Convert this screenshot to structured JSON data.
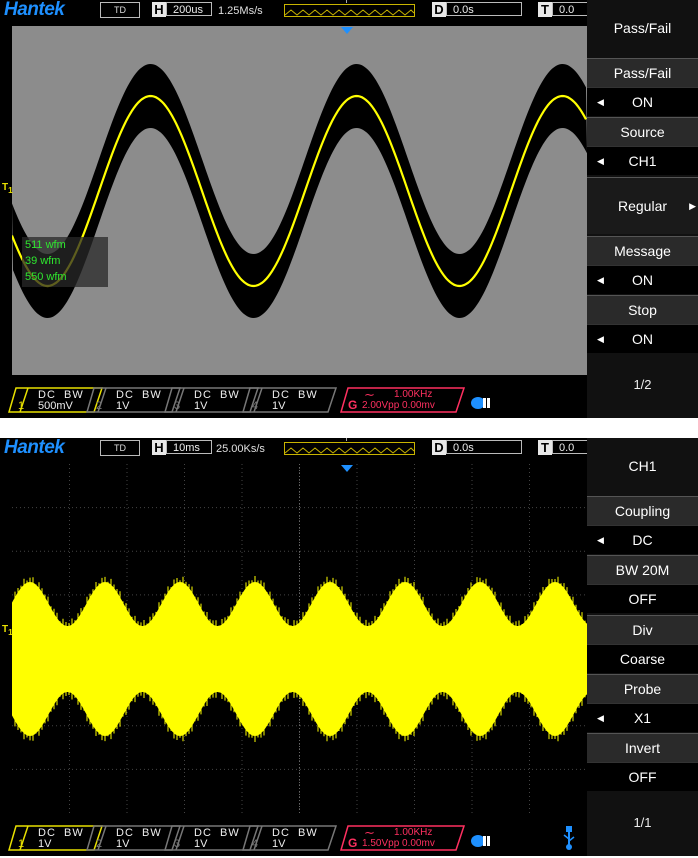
{
  "panels": [
    {
      "brand": "Hantek",
      "mode": "TD",
      "timebase_key": "H",
      "timebase": "200us",
      "sample_rate": "1.25Ms/s",
      "trigger_top_label": "T",
      "delay_key": "D",
      "delay": "0.0s",
      "trigger_key": "T",
      "trigger_value": "0.0",
      "ch_marker": "T",
      "ch_marker_sub": "1",
      "counters": [
        "511 wfm",
        "39 wfm",
        "550 wfm"
      ],
      "menu": {
        "title": "Pass/Fail",
        "items": [
          {
            "label": "Pass/Fail",
            "value": "ON"
          },
          {
            "label": "Source",
            "value": "CH1"
          },
          {
            "single": "Regular"
          },
          {
            "label": "Message",
            "value": "ON"
          },
          {
            "label": "Stop",
            "value": "ON"
          }
        ],
        "page": "1/2"
      },
      "channels": [
        {
          "num": "1",
          "coupling": "DC",
          "bw": "BW",
          "scale": "500mV",
          "color": "#e8e000"
        },
        {
          "num": "2",
          "coupling": "DC",
          "bw": "BW",
          "scale": "1V",
          "color": "#777777"
        },
        {
          "num": "3",
          "coupling": "DC",
          "bw": "BW",
          "scale": "1V",
          "color": "#777777"
        },
        {
          "num": "4",
          "coupling": "DC",
          "bw": "BW",
          "scale": "1V",
          "color": "#777777"
        }
      ],
      "generator": {
        "key": "G",
        "freq": "1.00KHz",
        "amp": "2.00Vpp 0.00mv"
      },
      "colors": {
        "screen_bg": "#8c8c8c",
        "trace": "#ffff00",
        "envelope": "#000000",
        "accent": "#1e90ff"
      }
    },
    {
      "brand": "Hantek",
      "mode": "TD",
      "timebase_key": "H",
      "timebase": "10ms",
      "sample_rate": "25.00Ks/s",
      "trigger_top_label": "T",
      "delay_key": "D",
      "delay": "0.0s",
      "trigger_key": "T",
      "trigger_value": "0.0",
      "ch_marker": "T",
      "ch_marker_sub": "1",
      "menu": {
        "title": "CH1",
        "items": [
          {
            "label": "Coupling",
            "value": "DC"
          },
          {
            "label": "BW 20M",
            "value": "OFF"
          },
          {
            "label": "Div",
            "value": "Coarse"
          },
          {
            "label": "Probe",
            "value": "X1"
          },
          {
            "label": "Invert",
            "value": "OFF"
          }
        ],
        "page": "1/1"
      },
      "channels": [
        {
          "num": "1",
          "coupling": "DC",
          "bw": "BW",
          "scale": "1V",
          "color": "#e8e000"
        },
        {
          "num": "2",
          "coupling": "DC",
          "bw": "BW",
          "scale": "1V",
          "color": "#777777"
        },
        {
          "num": "3",
          "coupling": "DC",
          "bw": "BW",
          "scale": "1V",
          "color": "#777777"
        },
        {
          "num": "4",
          "coupling": "DC",
          "bw": "BW",
          "scale": "1V",
          "color": "#777777"
        }
      ],
      "generator": {
        "key": "G",
        "freq": "1.00KHz",
        "amp": "1.50Vpp 0.00mv"
      },
      "colors": {
        "screen_bg": "#000000",
        "trace": "#ffff00",
        "grid": "#555555",
        "accent": "#1e90ff"
      }
    }
  ]
}
